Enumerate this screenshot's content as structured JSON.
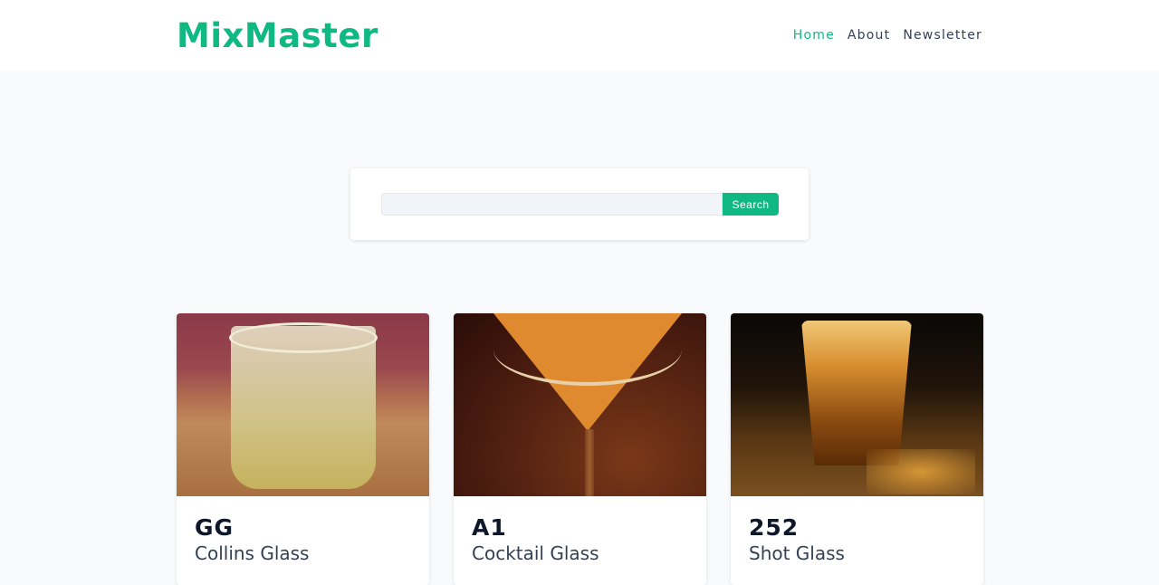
{
  "header": {
    "logo": "MixMaster",
    "nav": [
      {
        "label": "Home",
        "active": true
      },
      {
        "label": "About",
        "active": false
      },
      {
        "label": "Newsletter",
        "active": false
      }
    ]
  },
  "search": {
    "value": "",
    "placeholder": "",
    "button_label": "Search"
  },
  "cocktails": [
    {
      "name": "GG",
      "glass": "Collins Glass"
    },
    {
      "name": "A1",
      "glass": "Cocktail Glass"
    },
    {
      "name": "252",
      "glass": "Shot Glass"
    }
  ],
  "colors": {
    "accent": "#10b981",
    "background": "#f8fafc"
  }
}
